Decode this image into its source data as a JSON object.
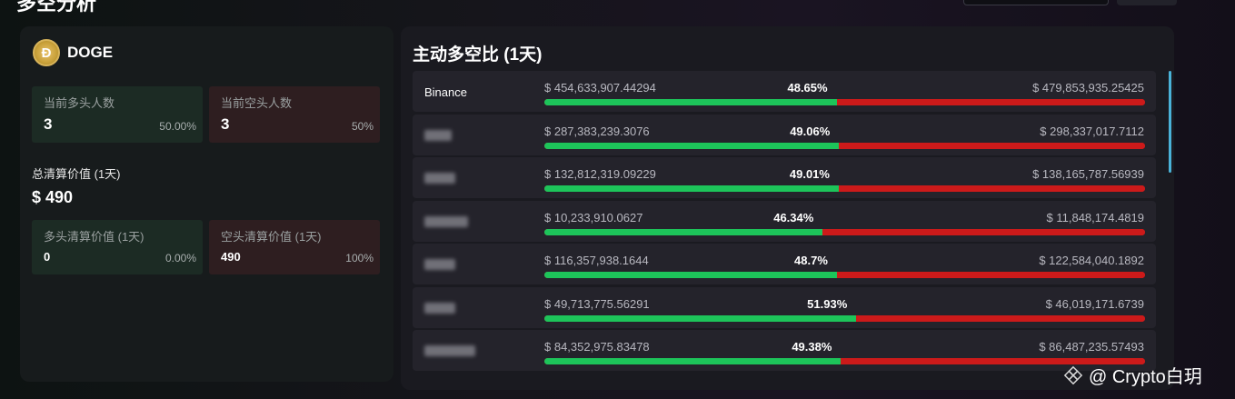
{
  "page": {
    "title": "多空分析"
  },
  "coin": {
    "symbol": "DOGE",
    "logo_glyph": "Ð"
  },
  "left": {
    "long_count_label": "当前多头人数",
    "long_count": "3",
    "long_count_pct": "50.00%",
    "short_count_label": "当前空头人数",
    "short_count": "3",
    "short_count_pct": "50%",
    "total_liq_label": "总清算价值 (1天)",
    "total_liq_value": "$ 490",
    "long_liq_label": "多头清算价值 (1天)",
    "long_liq_value": "0",
    "long_liq_pct": "0.00%",
    "short_liq_label": "空头清算价值 (1天)",
    "short_liq_value": "490",
    "short_liq_pct": "100%"
  },
  "ratio_panel": {
    "title": "主动多空比 (1天)",
    "rows": [
      {
        "exchange": "Binance",
        "long": "$ 454,633,907.44294",
        "pct": "48.65%",
        "long_fraction": 0.4865,
        "short": "$ 479,853,935.25425"
      },
      {
        "exchange": "",
        "long": "$ 287,383,239.3076",
        "pct": "49.06%",
        "long_fraction": 0.4906,
        "short": "$ 298,337,017.7112"
      },
      {
        "exchange": "",
        "long": "$ 132,812,319.09229",
        "pct": "49.01%",
        "long_fraction": 0.4901,
        "short": "$ 138,165,787.56939"
      },
      {
        "exchange": "",
        "long": "$ 10,233,910.0627",
        "pct": "46.34%",
        "long_fraction": 0.4634,
        "short": "$ 11,848,174.4819"
      },
      {
        "exchange": "",
        "long": "$ 116,357,938.1644",
        "pct": "48.7%",
        "long_fraction": 0.487,
        "short": "$ 122,584,040.1892"
      },
      {
        "exchange": "",
        "long": "$ 49,713,775.56291",
        "pct": "51.93%",
        "long_fraction": 0.5193,
        "short": "$ 46,019,171.6739"
      },
      {
        "exchange": "",
        "long": "$ 84,352,975.83478",
        "pct": "49.38%",
        "long_fraction": 0.4938,
        "short": "$ 86,487,235.57493"
      }
    ]
  },
  "watermark": {
    "text": "@ Crypto白玥",
    "icon": "binance-square-icon"
  },
  "colors": {
    "long": "#1dc45a",
    "short": "#cc1a1a",
    "scroll": "#4ab2d8"
  }
}
